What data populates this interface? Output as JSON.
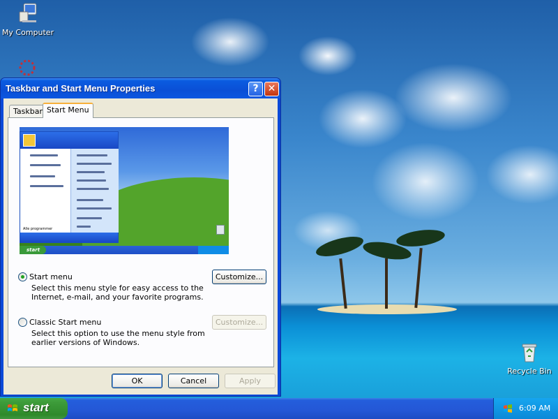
{
  "desktop": {
    "icons": {
      "my_computer": "My Computer",
      "recycle_bin": "Recycle Bin"
    }
  },
  "window": {
    "title": "Taskbar and Start Menu Properties",
    "help_glyph": "?",
    "close_glyph": "✕",
    "tabs": [
      {
        "label": "Taskbar",
        "active": false
      },
      {
        "label": "Start Menu",
        "active": true
      }
    ],
    "preview": {
      "start_label": "start",
      "all_programs_label": "Alle programmer"
    },
    "options": {
      "start_menu": {
        "label": "Start menu",
        "selected": true,
        "description": "Select this menu style for easy access to the Internet, e-mail, and your favorite programs.",
        "customize_label": "Customize..."
      },
      "classic_start_menu": {
        "label": "Classic Start menu",
        "selected": false,
        "description": "Select this option to use the menu style from earlier versions of Windows.",
        "customize_label": "Customize..."
      }
    },
    "buttons": {
      "ok": "OK",
      "cancel": "Cancel",
      "apply": "Apply"
    }
  },
  "taskbar": {
    "start_label": "start",
    "clock": "6:09 AM"
  },
  "colors": {
    "titlebar": "#0a4fd6",
    "start_button": "#3d9c3a",
    "taskbar": "#245edc",
    "dialog_face": "#ece9d8"
  }
}
